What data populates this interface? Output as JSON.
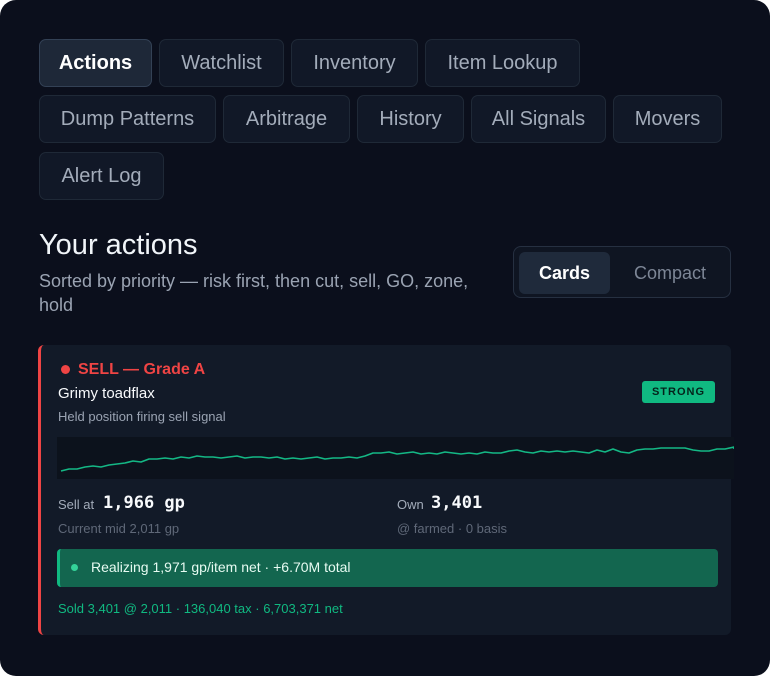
{
  "tabs": [
    {
      "label": "Actions",
      "active": true
    },
    {
      "label": "Watchlist"
    },
    {
      "label": "Inventory"
    },
    {
      "label": "Item Lookup"
    },
    {
      "label": "Dump Patterns"
    },
    {
      "label": "Arbitrage"
    },
    {
      "label": "History"
    },
    {
      "label": "All Signals"
    },
    {
      "label": "Movers"
    },
    {
      "label": "Alert Log"
    }
  ],
  "section": {
    "title": "Your actions",
    "subtitle": "Sorted by priority — risk first, then cut, sell, GO, zone, hold"
  },
  "view_toggle": {
    "cards": "Cards",
    "compact": "Compact",
    "selected": "Cards"
  },
  "card": {
    "signal": "SELL — Grade A",
    "item": "Grimy toadflax",
    "description": "Held position firing sell signal",
    "badge": "STRONG",
    "sell_label": "Sell at",
    "sell_value": "1,966 gp",
    "sell_sub": "Current mid 2,011 gp",
    "own_label": "Own",
    "own_value": "3,401",
    "own_sub": "@ farmed · 0 basis",
    "realize_text": "Realizing 1,971 gp/item net · +6.70M total",
    "footer": "Sold 3,401 @ 2,011 · 136,040 tax · 6,703,371 net",
    "colors": {
      "accent": "#ef4444",
      "positive": "#10b981",
      "background": "#121a28"
    }
  }
}
